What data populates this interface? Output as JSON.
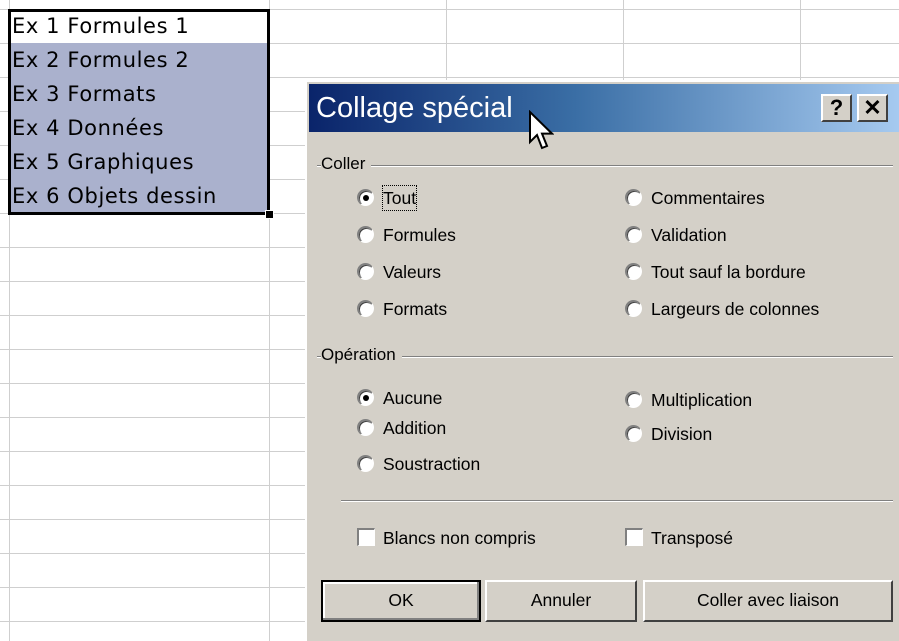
{
  "sheet": {
    "cells": [
      "Ex 1 Formules 1",
      "Ex 2 Formules 2",
      "Ex 3 Formats",
      "Ex 4 Données",
      "Ex 5 Graphiques",
      "Ex 6 Objets dessin"
    ]
  },
  "dialog": {
    "title": "Collage spécial",
    "help_label": "?",
    "close_label": "✕",
    "coller": {
      "label": "Coller",
      "options": [
        "Tout",
        "Formules",
        "Valeurs",
        "Formats",
        "Commentaires",
        "Validation",
        "Tout sauf la bordure",
        "Largeurs de colonnes"
      ],
      "selected": "Tout"
    },
    "operation": {
      "label": "Opération",
      "options": [
        "Aucune",
        "Addition",
        "Soustraction",
        "Multiplication",
        "Division"
      ],
      "selected": "Aucune"
    },
    "checkboxes": {
      "blancs": {
        "label": "Blancs non compris",
        "checked": false
      },
      "transpose": {
        "label": "Transposé",
        "checked": false
      }
    },
    "buttons": {
      "ok": "OK",
      "annuler": "Annuler",
      "coller_liaison": "Coller avec liaison"
    }
  },
  "colors": {
    "selection": "#aab1cd",
    "dialog_face": "#d4d0c8",
    "titlebar_start": "#0a246a",
    "titlebar_end": "#a6caf0"
  }
}
